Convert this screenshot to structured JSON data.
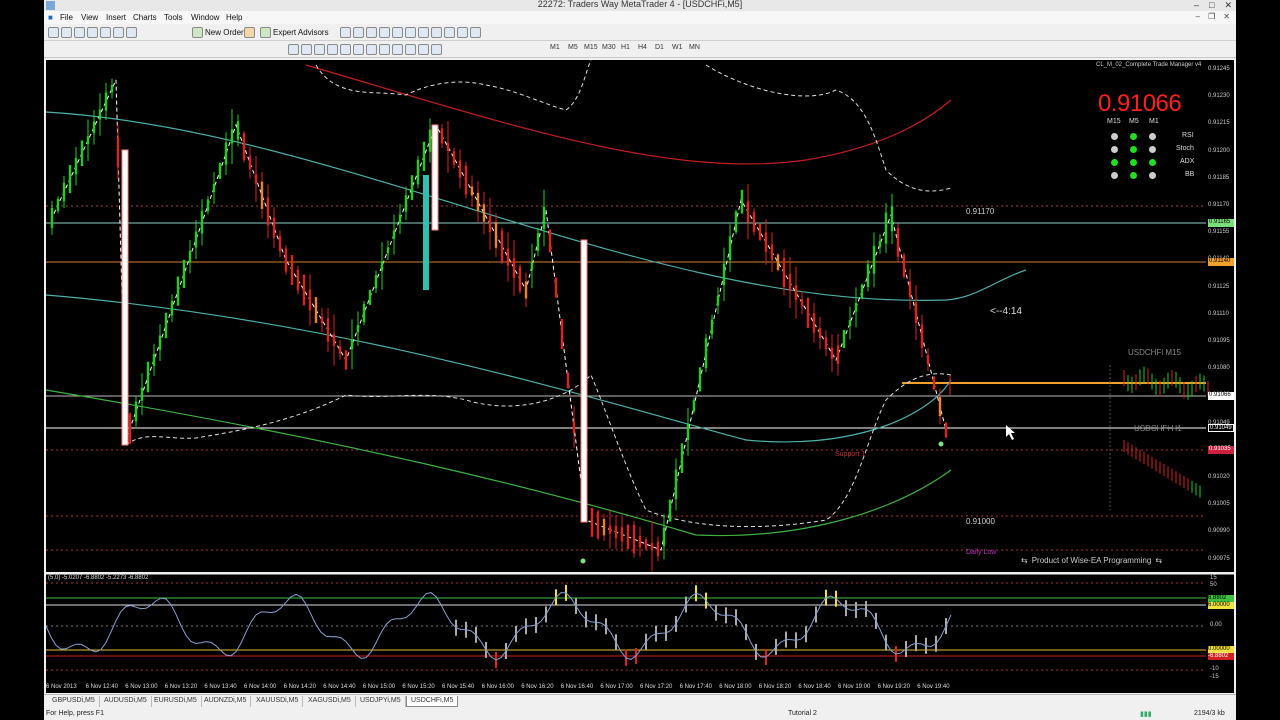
{
  "window": {
    "title": "22272: Traders Way MetaTrader 4 - [USDCHFi,M5]"
  },
  "menu": [
    "File",
    "View",
    "Insert",
    "Charts",
    "Tools",
    "Window",
    "Help"
  ],
  "toolbar": {
    "new_order": "New Order",
    "expert_advisors": "Expert Advisors",
    "timeframes": [
      "M1",
      "M5",
      "M15",
      "M30",
      "H1",
      "H4",
      "D1",
      "W1",
      "MN"
    ]
  },
  "chart": {
    "symbol": "USDCHFi,M5",
    "panel_title": "CL_M_02_Complete Trade Manager v4",
    "panel_price": "0.91066",
    "panel_cols": [
      "M15",
      "M5",
      "M1"
    ],
    "panel_rows": [
      {
        "name": "RSI",
        "colors": [
          "#cccccc",
          "#22dd22",
          "#cccccc"
        ]
      },
      {
        "name": "Stoch",
        "colors": [
          "#cccccc",
          "#22dd22",
          "#cccccc"
        ]
      },
      {
        "name": "ADX",
        "colors": [
          "#22dd22",
          "#22dd22",
          "#22dd22"
        ]
      },
      {
        "name": "BB",
        "colors": [
          "#cccccc",
          "#22dd22",
          "#cccccc"
        ]
      }
    ],
    "level_upper": "0.91170",
    "level_lower": "0.91000",
    "countdown": "<--4:14",
    "support_label": "Support 1",
    "daily_low_label": "Daily Low",
    "mini_m15": "USDCHFi M15",
    "mini_h1": "USDCHFi H1",
    "product": "Product of Wise-EA Programming",
    "price_ticks": [
      "0.91245",
      "0.91230",
      "0.91215",
      "0.91200",
      "0.91185",
      "0.91170",
      "0.91155",
      "0.91140",
      "0.91125",
      "0.91110",
      "0.91095",
      "0.91080",
      "0.91066",
      "0.91049",
      "0.91035",
      "0.91020",
      "0.91005",
      "0.90990",
      "0.90975"
    ],
    "price_label_current": "0.91066",
    "price_label_upper": "0.91165",
    "price_label_mid": "0.91140",
    "price_label_low": "0.91049",
    "price_label_red": "0.91035"
  },
  "indicator": {
    "label": "(5,0) -5.0207 -6.8802 -5.2273 -6.8802",
    "scale": [
      "15",
      "50",
      "0.00",
      "-10",
      "-15"
    ],
    "marker_green": "6.8802",
    "marker_yellow": "6.00000",
    "marker_zero": "0.00000",
    "marker_red": "-6.8802"
  },
  "time_labels": [
    "6 Nov 2013",
    "6 Nov 12:40",
    "6 Nov 13:00",
    "6 Nov 13:20",
    "6 Nov 13:40",
    "6 Nov 14:00",
    "6 Nov 14:20",
    "6 Nov 14:40",
    "6 Nov 15:00",
    "6 Nov 15:20",
    "6 Nov 15:40",
    "6 Nov 16:00",
    "6 Nov 16:20",
    "6 Nov 16:40",
    "6 Nov 17:00",
    "6 Nov 17:20",
    "6 Nov 17:40",
    "6 Nov 18:00",
    "6 Nov 18:20",
    "6 Nov 18:40",
    "6 Nov 19:00",
    "6 Nov 19:20",
    "6 Nov 19:40"
  ],
  "tabs": [
    "GBPUSDi,M5",
    "AUDUSDi,M5",
    "EURUSDi,M5",
    "AUDNZDi,M5",
    "XAUUSDi,M5",
    "XAGUSDi,M5",
    "USDJPYi,M5",
    "USDCHFi,M5"
  ],
  "active_tab": 7,
  "status": {
    "help": "For Help, press F1",
    "profile": "Tutorial 2",
    "traffic": "2194/3 kb"
  }
}
